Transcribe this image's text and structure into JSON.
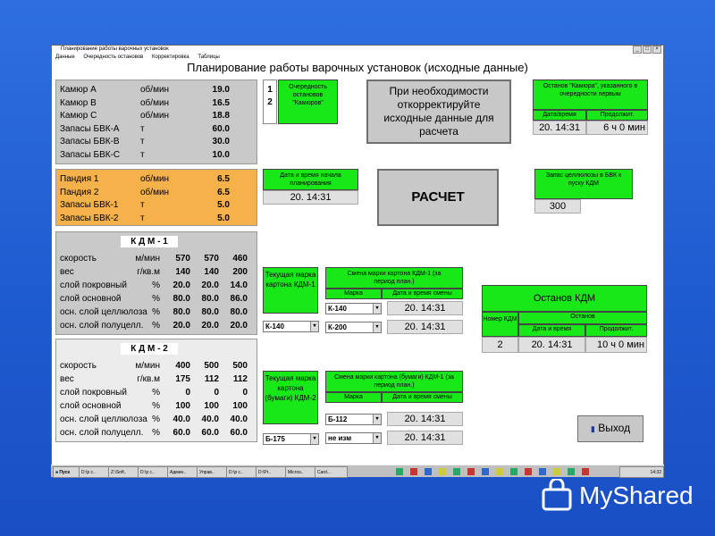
{
  "window": {
    "title": "Планирование работы варочных установок",
    "menu": [
      "Данные",
      "Очередность остановов",
      "Корректировка",
      "Таблицы"
    ],
    "heading": "Планирование работы варочных установок (исходные данные)"
  },
  "kamyur": {
    "rows": [
      {
        "name": "Камюр А",
        "unit": "об/мин",
        "value": "19.0"
      },
      {
        "name": "Камюр В",
        "unit": "об/мин",
        "value": "16.5"
      },
      {
        "name": "Камюр С",
        "unit": "об/мин",
        "value": "18.8"
      },
      {
        "name": "Запасы БВК-А",
        "unit": "т",
        "value": "60.0"
      },
      {
        "name": "Запасы БВК-В",
        "unit": "т",
        "value": "30.0"
      },
      {
        "name": "Запасы БВК-С",
        "unit": "т",
        "value": "10.0"
      }
    ]
  },
  "pandia": {
    "rows": [
      {
        "name": "Пандия 1",
        "unit": "об/мин",
        "value": "6.5"
      },
      {
        "name": "Пандия 2",
        "unit": "об/мин",
        "value": "6.5"
      },
      {
        "name": "Запасы БВК-1",
        "unit": "т",
        "value": "5.0"
      },
      {
        "name": "Запасы БВК-2",
        "unit": "т",
        "value": "5.0"
      }
    ]
  },
  "kdm1": {
    "title": "К Д М - 1",
    "rows": [
      {
        "name": "скорость",
        "unit": "м/мин",
        "v1": "570",
        "v2": "570",
        "v3": "460"
      },
      {
        "name": "вес",
        "unit": "г/кв.м",
        "v1": "140",
        "v2": "140",
        "v3": "200"
      },
      {
        "name": "слой покровный",
        "unit": "%",
        "v1": "20.0",
        "v2": "20.0",
        "v3": "14.0"
      },
      {
        "name": "слой основной",
        "unit": "%",
        "v1": "80.0",
        "v2": "80.0",
        "v3": "86.0"
      },
      {
        "name": "осн. слой целлюлоза",
        "unit": "%",
        "v1": "80.0",
        "v2": "80.0",
        "v3": "80.0"
      },
      {
        "name": "осн. слой полуцелл.",
        "unit": "%",
        "v1": "20.0",
        "v2": "20.0",
        "v3": "20.0"
      }
    ]
  },
  "kdm2": {
    "title": "К Д М - 2",
    "rows": [
      {
        "name": "скорость",
        "unit": "м/мин",
        "v1": "400",
        "v2": "500",
        "v3": "500"
      },
      {
        "name": "вес",
        "unit": "г/кв.м",
        "v1": "175",
        "v2": "112",
        "v3": "112"
      },
      {
        "name": "слой покровный",
        "unit": "%",
        "v1": "0",
        "v2": "0",
        "v3": "0"
      },
      {
        "name": "слой основной",
        "unit": "%",
        "v1": "100",
        "v2": "100",
        "v3": "100"
      },
      {
        "name": "осн. слой целлюлоза",
        "unit": "%",
        "v1": "40.0",
        "v2": "40.0",
        "v3": "40.0"
      },
      {
        "name": "осн. слой полуцелл.",
        "unit": "%",
        "v1": "60.0",
        "v2": "60.0",
        "v3": "60.0"
      }
    ]
  },
  "order": {
    "numbers": [
      "1",
      "2"
    ],
    "label": "Очередность остановов \"Камюров\""
  },
  "notice": "При необходимости откорректируйте исходные данные для расчета",
  "stopKamyur": {
    "title": "Останов \"Камюра\", указанного в очередности первым",
    "col_datetime": "Дата/время",
    "col_duration": "Продолжит.",
    "datetime": "20. 14:31",
    "duration": "6 ч 0 мин"
  },
  "planStart": {
    "label": "Дата и время начала планирования",
    "value": "20. 14:31"
  },
  "calcButton": "РАСЧЕТ",
  "reserve": {
    "label": "Запас целлюлозы в БВК к пуску КДМ",
    "value": "300"
  },
  "grade1": {
    "label": "Текущая марка картона КДМ-1",
    "current": "К-140",
    "changeTitle": "Смена марки картона КДМ-1 (за период план.)",
    "col_mark": "Марка",
    "col_datetime": "Дата и время смены",
    "changes": [
      {
        "mark": "К-140",
        "datetime": "20. 14:31"
      },
      {
        "mark": "К-200",
        "datetime": "20. 14:31"
      }
    ]
  },
  "grade2": {
    "label": "Текущая марка картона (бумаги) КДМ-2",
    "current": "Б-175",
    "changeTitle": "Смена марки картона (бумаги) КДМ-1 (за период план.)",
    "col_mark": "Марка",
    "col_datetime": "Дата и время смены",
    "changes": [
      {
        "mark": "Б-112",
        "datetime": "20. 14:31"
      },
      {
        "mark": "не изм",
        "datetime": "20. 14:31"
      }
    ]
  },
  "stopKdm": {
    "title": "Останов КДМ",
    "col_num": "Номер КДМ",
    "col_stop": "Останов",
    "col_datetime": "Дата и время",
    "col_duration": "Продолжит.",
    "num": "2",
    "datetime": "20. 14:31",
    "duration": "10 ч 0 мин"
  },
  "exitButton": "Выход",
  "taskbar": {
    "start": "Пуск",
    "items": [
      "D:\\p c..",
      "Z:\\Soft..",
      "D:\\p c..",
      "Админ..",
      "Управ..",
      "D:\\p c..",
      "D:\\Pr..",
      "Micros..",
      "Card..."
    ],
    "clock": "14:32"
  },
  "watermark": "MyShared"
}
